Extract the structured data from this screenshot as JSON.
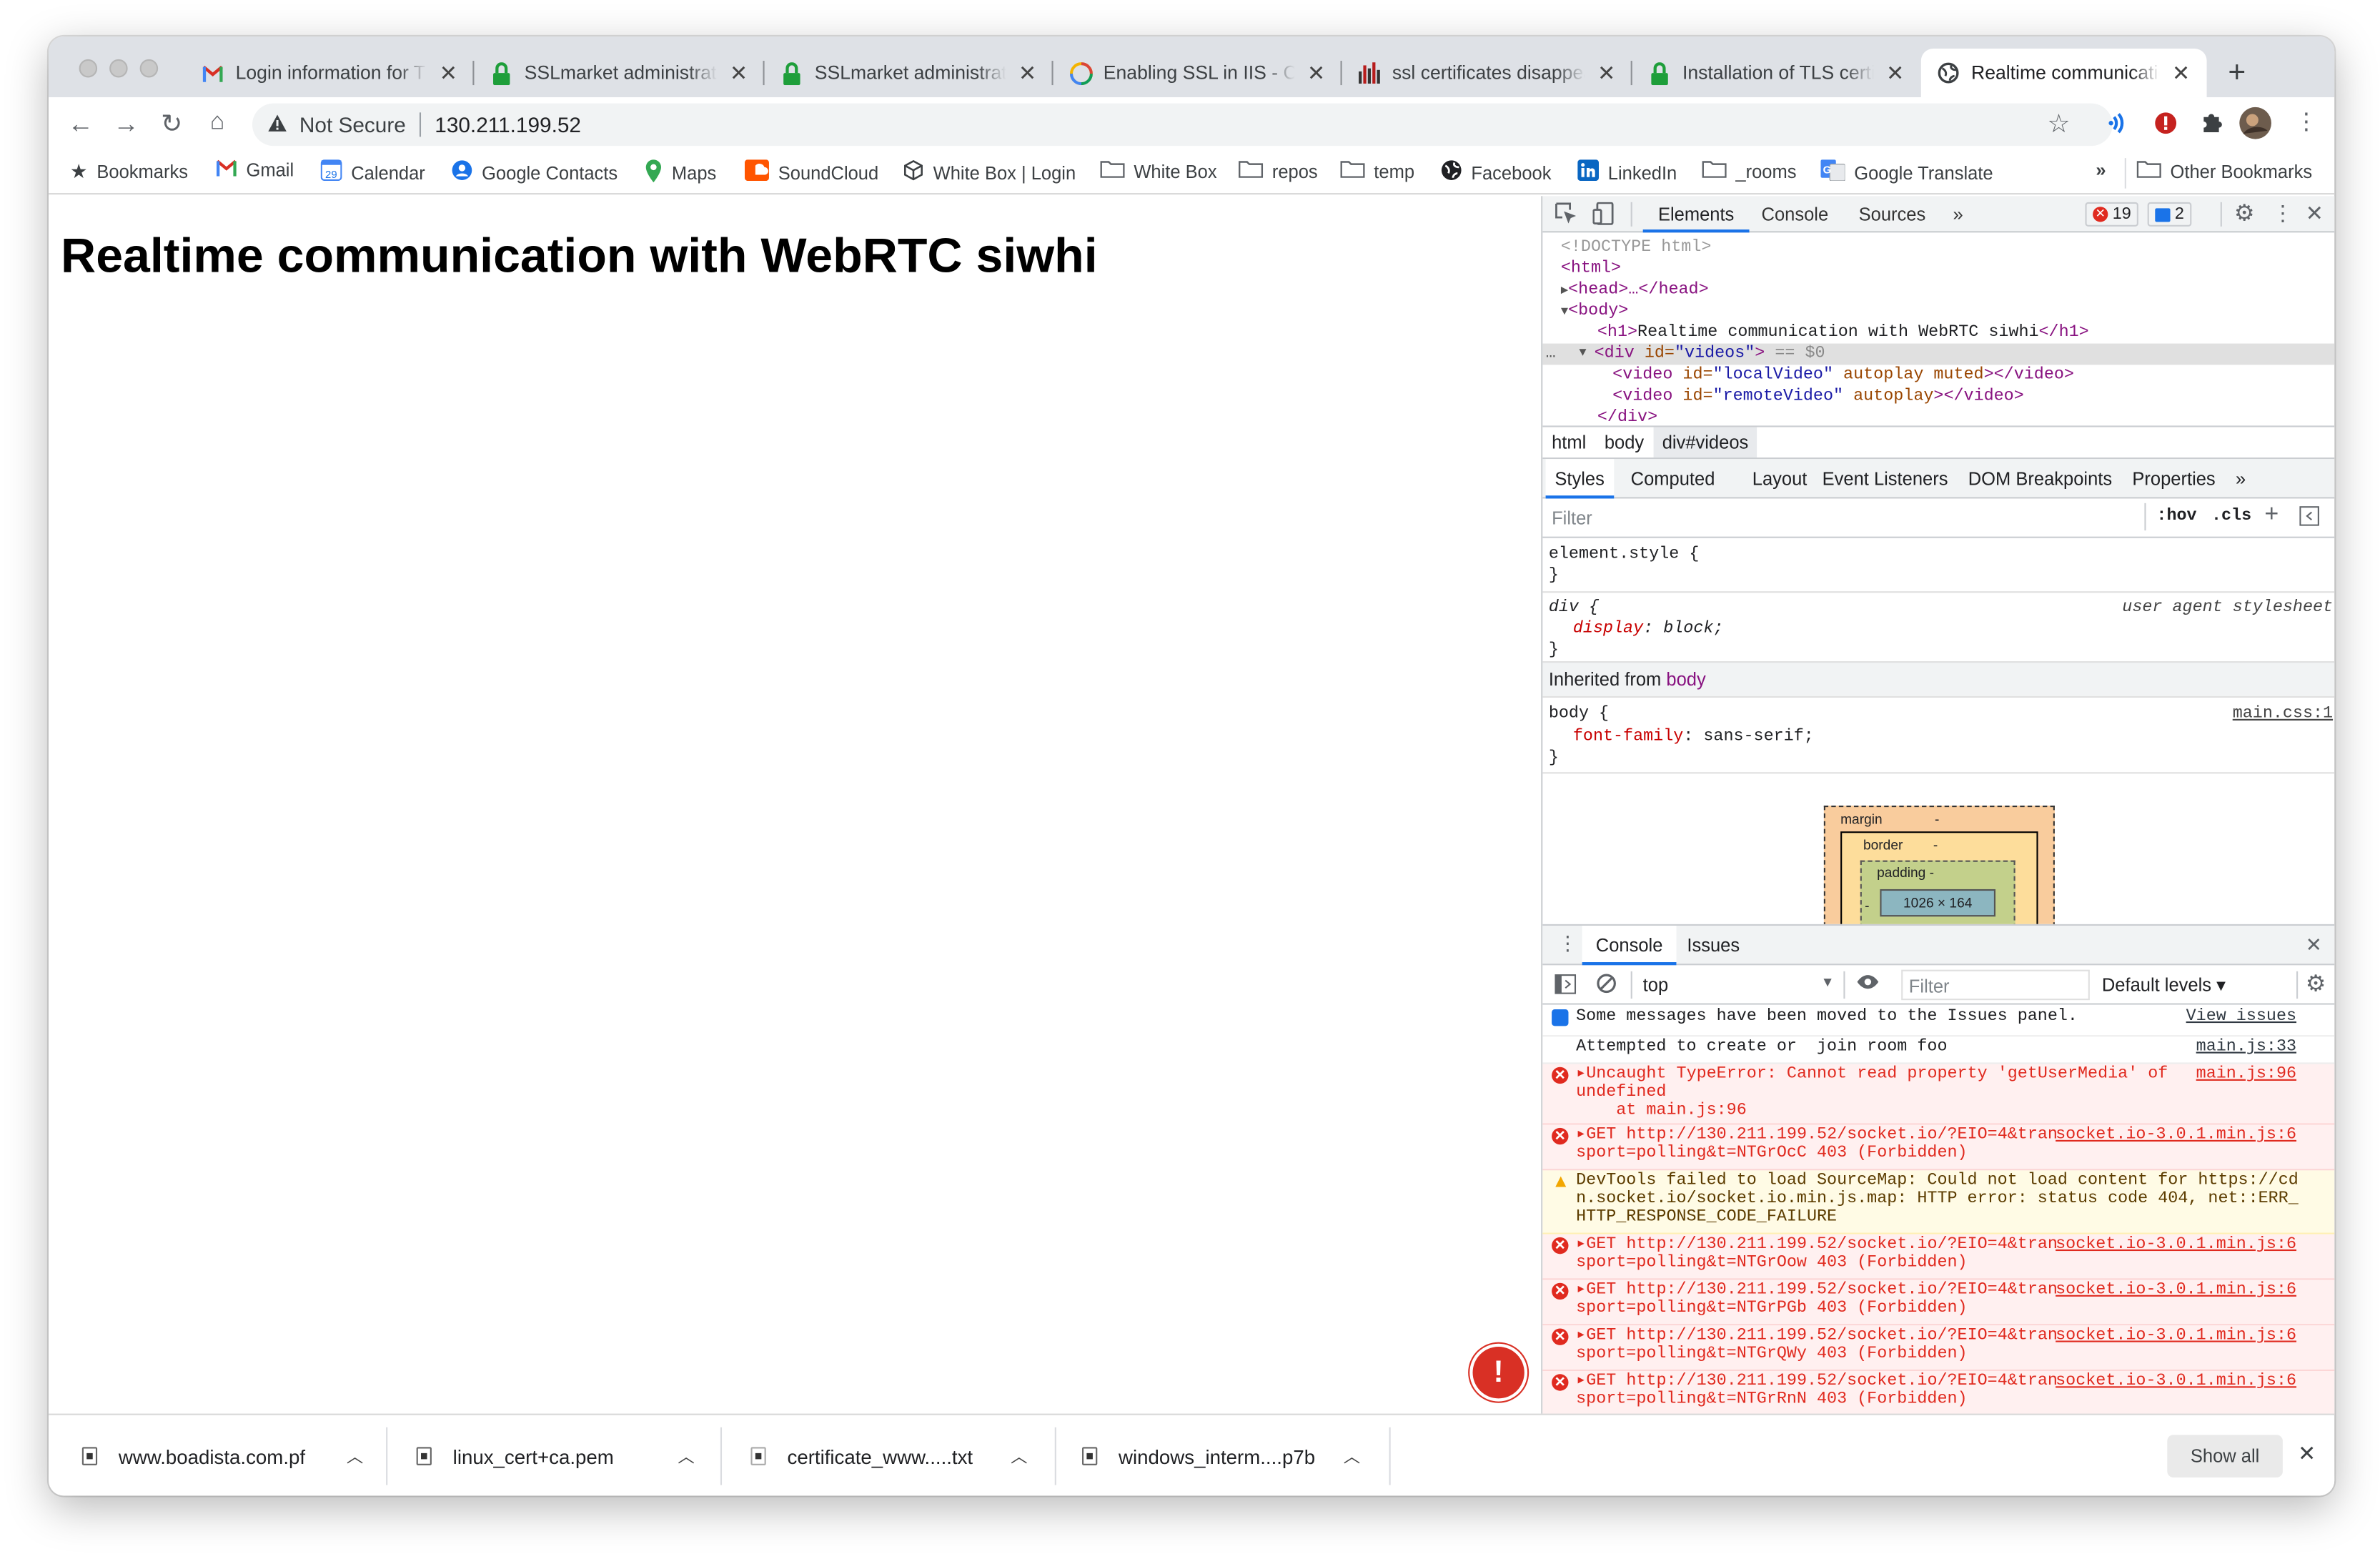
{
  "tabs": [
    {
      "title": "Login information for TLS",
      "icon": "gmail-icon"
    },
    {
      "title": "SSLmarket administration",
      "icon": "lock-icon"
    },
    {
      "title": "SSLmarket administration",
      "icon": "lock-icon"
    },
    {
      "title": "Enabling SSL in IIS - Cov",
      "icon": "pinwheel-icon"
    },
    {
      "title": "ssl certificates disappear",
      "icon": "bars-icon"
    },
    {
      "title": "Installation of TLS certificate",
      "icon": "lock-icon"
    },
    {
      "title": "Realtime communication",
      "icon": "globe-icon"
    }
  ],
  "address": {
    "security": "Not Secure",
    "url": "130.211.199.52"
  },
  "bookmarks": [
    {
      "label": "Bookmarks",
      "icon": "star-icon"
    },
    {
      "label": "Gmail",
      "icon": "gmail-icon"
    },
    {
      "label": "Calendar",
      "icon": "calendar-icon"
    },
    {
      "label": "Google Contacts",
      "icon": "contacts-icon"
    },
    {
      "label": "Maps",
      "icon": "maps-icon"
    },
    {
      "label": "SoundCloud",
      "icon": "soundcloud-icon"
    },
    {
      "label": "White Box | Login",
      "icon": "cube-icon"
    },
    {
      "label": "White Box",
      "icon": "folder-icon"
    },
    {
      "label": "repos",
      "icon": "folder-icon"
    },
    {
      "label": "temp",
      "icon": "folder-icon"
    },
    {
      "label": "Facebook",
      "icon": "globe-icon"
    },
    {
      "label": "LinkedIn",
      "icon": "linkedin-icon"
    },
    {
      "label": "_rooms",
      "icon": "folder-icon"
    },
    {
      "label": "Google Translate",
      "icon": "translate-icon"
    }
  ],
  "bookmarks_more": "»",
  "other_bookmarks": "Other Bookmarks",
  "page": {
    "heading": "Realtime communication with WebRTC siwhi"
  },
  "devtools": {
    "tabs": [
      "Elements",
      "Console",
      "Sources",
      "»"
    ],
    "errors": "19",
    "messages": "2",
    "dom": {
      "doctype": "<!DOCTYPE html>",
      "html": "<html>",
      "head": "<head>…</head>",
      "body": "<body>",
      "h1_open": "<h1>",
      "h1_text": "Realtime communication with WebRTC siwhi",
      "h1_close": "</h1>",
      "div_open": "<div ",
      "div_attr": "id=",
      "div_val": "\"videos\"",
      "div_end": ">",
      "div_sel": " == $0",
      "video1_tag": "<video ",
      "video1_attr": "id=",
      "video1_val": "\"localVideo\"",
      "video1_rest": " autoplay muted",
      "video1_close": "></video>",
      "video2_tag": "<video ",
      "video2_attr": "id=",
      "video2_val": "\"remoteVideo\"",
      "video2_rest": " autoplay",
      "video2_close": "></video>",
      "div_close": "</div>"
    },
    "breadcrumbs": [
      "html",
      "body",
      "div#videos"
    ],
    "subtabs": [
      "Styles",
      "Computed",
      "Layout",
      "Event Listeners",
      "DOM Breakpoints",
      "Properties",
      "»"
    ],
    "filter_placeholder": "Filter",
    "hov": ":hov",
    "cls": ".cls",
    "styles": {
      "element_style": "element.style {",
      "close1": "}",
      "div_sel": "div {",
      "div_src": "user agent stylesheet",
      "div_prop": "display",
      "div_val": "block;",
      "close2": "}",
      "inherited_label": "Inherited from ",
      "inherited_from": "body",
      "body_sel": "body {",
      "body_src": "main.css:1",
      "body_prop": "font-family",
      "body_val": "sans-serif;",
      "close3": "}"
    },
    "boxmodel": {
      "margin": "margin",
      "margin_val": "-",
      "border": "border",
      "border_val": "-",
      "padding": "padding -",
      "dims": "1026 × 164",
      "dash": "-"
    },
    "console": {
      "tabs": [
        "Console",
        "Issues"
      ],
      "context": "top",
      "filter_placeholder": "Filter",
      "levels": "Default levels ▾",
      "messages": [
        {
          "kind": "info",
          "text": "Some messages have been moved to the Issues panel.",
          "src": "View issues"
        },
        {
          "kind": "log",
          "text": "Attempted to create or  join room foo",
          "src": "main.js:33"
        },
        {
          "kind": "error",
          "text": "▸Uncaught TypeError: Cannot read property 'getUserMedia' of undefined\n    at main.js:96",
          "src": "main.js:96"
        },
        {
          "kind": "error",
          "text": "▸GET http://130.211.199.52/socket.io/?EIO=4&transport=polling&t=NTGrOcC 403 (Forbidden)",
          "src": "socket.io-3.0.1.min.js:6"
        },
        {
          "kind": "warning",
          "text": "DevTools failed to load SourceMap: Could not load content for https://cdn.socket.io/socket.io.min.js.map: HTTP error: status code 404, net::ERR_HTTP_RESPONSE_CODE_FAILURE",
          "src": ""
        },
        {
          "kind": "error",
          "text": "▸GET http://130.211.199.52/socket.io/?EIO=4&transport=polling&t=NTGrOow 403 (Forbidden)",
          "src": "socket.io-3.0.1.min.js:6"
        },
        {
          "kind": "error",
          "text": "▸GET http://130.211.199.52/socket.io/?EIO=4&transport=polling&t=NTGrPGb 403 (Forbidden)",
          "src": "socket.io-3.0.1.min.js:6"
        },
        {
          "kind": "error",
          "text": "▸GET http://130.211.199.52/socket.io/?EIO=4&transport=polling&t=NTGrQWy 403 (Forbidden)",
          "src": "socket.io-3.0.1.min.js:6"
        },
        {
          "kind": "error",
          "text": "▸GET http://130.211.199.52/socket.io/?EIO=4&transport=polling&t=NTGrRnN 403 (Forbidden)",
          "src": "socket.io-3.0.1.min.js:6"
        }
      ]
    }
  },
  "downloads": [
    {
      "name": "www.boadista.com.pf"
    },
    {
      "name": "linux_cert+ca.pem"
    },
    {
      "name": "certificate_www.....txt"
    },
    {
      "name": "windows_interm....p7b"
    }
  ],
  "show_all": "Show all",
  "colors": {
    "accent": "#1a73e8",
    "error": "#e02a1f",
    "tabbar": "#dee1e6"
  }
}
